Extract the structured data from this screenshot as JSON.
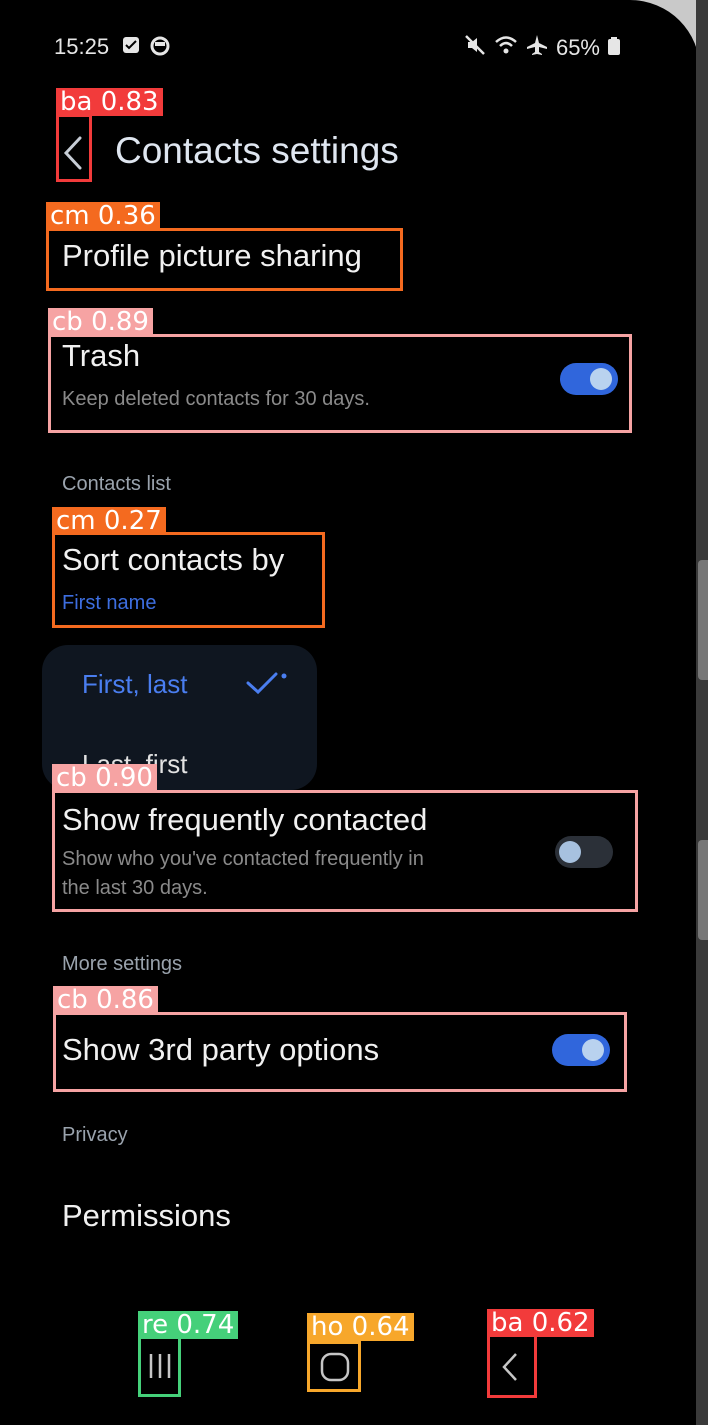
{
  "status": {
    "time": "15:25",
    "battery": "65%"
  },
  "header": {
    "title": "Contacts settings"
  },
  "items": {
    "profile": {
      "title": "Profile picture sharing"
    },
    "trash": {
      "title": "Trash",
      "subtitle": "Keep deleted contacts for 30 days.",
      "on": true
    },
    "contacts_list_header": "Contacts list",
    "sort": {
      "title": "Sort contacts by",
      "value": "First name"
    },
    "sort_options": [
      "First, last",
      "Last, first"
    ],
    "frequent": {
      "title": "Show frequently contacted",
      "subtitle_line1": "Show who you've contacted frequently in",
      "subtitle_line2": "the last 30 days.",
      "on": false
    },
    "more_settings_header": "More settings",
    "third_party": {
      "title": "Show 3rd party options",
      "on": true
    },
    "privacy_header": "Privacy",
    "permissions": {
      "title": "Permissions"
    }
  },
  "detections": [
    {
      "label": "ba 0.83",
      "color": "#f23b3b"
    },
    {
      "label": "cm 0.36",
      "color": "#f46a1f"
    },
    {
      "label": "cb 0.89",
      "color": "#f6a3a3"
    },
    {
      "label": "cm 0.27",
      "color": "#f46a1f"
    },
    {
      "label": "cb 0.90",
      "color": "#f6a3a3"
    },
    {
      "label": "cb 0.86",
      "color": "#f6a3a3"
    },
    {
      "label": "re 0.74",
      "color": "#45d07a"
    },
    {
      "label": "ho 0.64",
      "color": "#f7a72b"
    },
    {
      "label": "ba 0.62",
      "color": "#f23b3b"
    }
  ],
  "colors": {
    "accent": "#3066dc",
    "background": "#000000"
  }
}
